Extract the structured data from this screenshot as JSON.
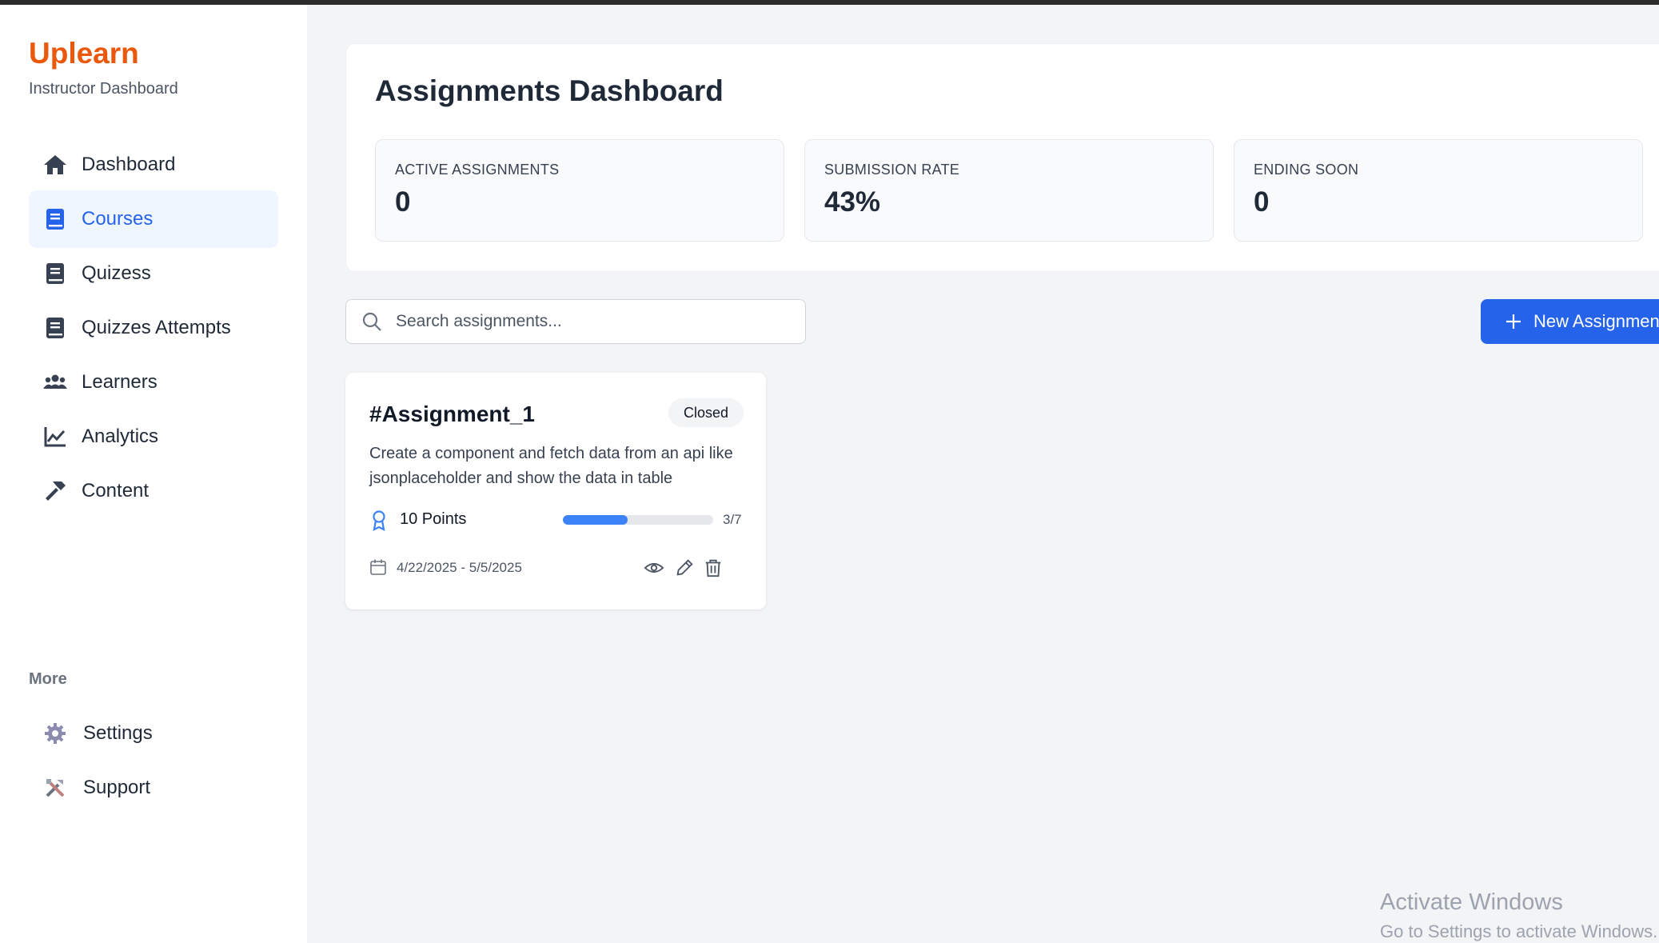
{
  "brand": {
    "name": "Uplearn",
    "subtitle": "Instructor Dashboard"
  },
  "sidebar": {
    "items": [
      {
        "label": "Dashboard",
        "icon": "home-icon"
      },
      {
        "label": "Courses",
        "icon": "book-icon",
        "active": true
      },
      {
        "label": "Quizess",
        "icon": "book-icon"
      },
      {
        "label": "Quizzes Attempts",
        "icon": "book-icon"
      },
      {
        "label": "Learners",
        "icon": "users-icon"
      },
      {
        "label": "Analytics",
        "icon": "chart-line-icon"
      },
      {
        "label": "Content",
        "icon": "hammer-icon"
      }
    ],
    "more_label": "More",
    "more_items": [
      {
        "label": "Settings",
        "icon": "gear-icon"
      },
      {
        "label": "Support",
        "icon": "tools-icon"
      }
    ]
  },
  "main": {
    "title": "Assignments Dashboard",
    "stats": [
      {
        "label": "ACTIVE ASSIGNMENTS",
        "value": "0"
      },
      {
        "label": "SUBMISSION RATE",
        "value": "43%"
      },
      {
        "label": "ENDING SOON",
        "value": "0"
      }
    ],
    "search": {
      "placeholder": "Search assignments...",
      "value": ""
    },
    "new_button_label": "New Assignment",
    "assignments": [
      {
        "title": "#Assignment_1",
        "status": "Closed",
        "description": "Create a component and fetch data from an api like jsonplaceholder and show the data in table",
        "points": "10 Points",
        "submissions": "3/7",
        "progress_fraction": 0.43,
        "dates": "4/22/2025 - 5/5/2025"
      }
    ]
  },
  "os_watermark": {
    "line1": "Activate Windows",
    "line2": "Go to Settings to activate Windows."
  },
  "colors": {
    "brand": "#ea580c",
    "accent": "#2563eb",
    "active_bg": "#eff6ff",
    "progress": "#3b82f6"
  }
}
